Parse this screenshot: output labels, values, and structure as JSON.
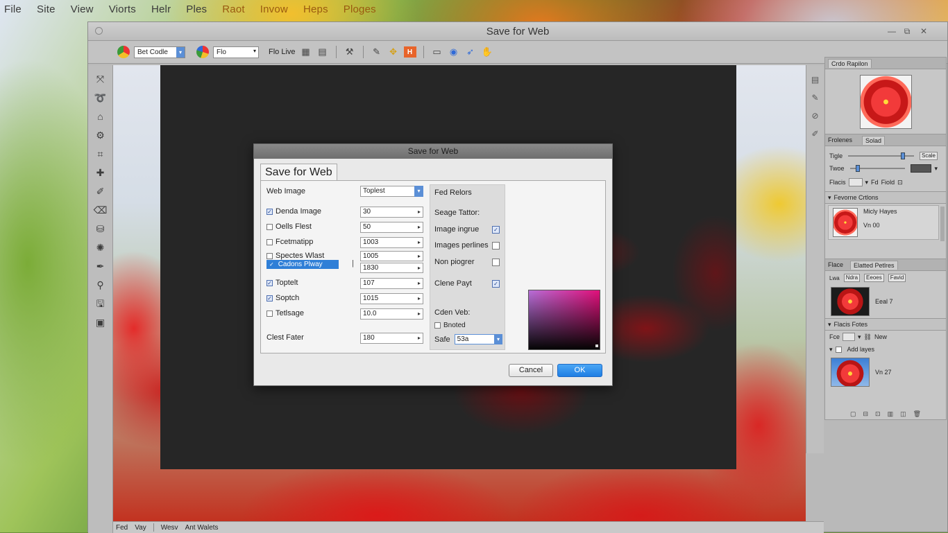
{
  "os_menu": [
    "File",
    "Site",
    "View",
    "Viorts",
    "Helr",
    "Ples",
    "Raot",
    "Invow",
    "Heps",
    "Ploges"
  ],
  "app": {
    "title": "Save for Web",
    "window_controls": [
      "—",
      "⧉",
      "✕"
    ]
  },
  "options_bar": {
    "select1": "Bet Codle",
    "select2": "Flo",
    "label": "Flo Live"
  },
  "statusbar": [
    "Fed",
    "Vay",
    "Wesv",
    "Ant Walets"
  ],
  "panels": {
    "color_sample": {
      "tab": "Crdo Rapilon"
    },
    "properties": {
      "tab1": "Frolenes",
      "tab2": "Solad",
      "row1_label": "Tigle",
      "row1_value": "Scale",
      "row2_label": "Twoe",
      "row3_label": "Flacis",
      "row3_extra": "Fd",
      "row3_select": "Fiold"
    },
    "favorites": {
      "header": "Fevorne Crtlons",
      "item_title": "Micly Hayes",
      "item_sub": "Vn 00"
    },
    "layers": {
      "tab1": "Flace",
      "tab2": "Elatted Petlres",
      "controls": [
        "Lwa",
        "Ndra",
        "Eeoes",
        "Favid"
      ],
      "item1": "Eeal 7"
    },
    "flat": {
      "header": "Flacis Fotes",
      "row_label": "Fce",
      "new_label": "New",
      "add_label": "Add layes",
      "item": "Vn 27"
    }
  },
  "dialog": {
    "title": "Save for Web",
    "tab": "Save for Web",
    "web_image_label": "Web Image",
    "web_image_value": "Toplest",
    "options": [
      {
        "label": "Denda Image",
        "checked": true,
        "value": "30"
      },
      {
        "label": "Oells Flest",
        "checked": false,
        "value": "50"
      },
      {
        "label": "Fcetmatipp",
        "checked": false,
        "value": "1003"
      },
      {
        "label": "Spectes Wlast",
        "checked": false,
        "value": "1005"
      },
      {
        "label": "Cadons Plway",
        "checked": true,
        "value": "1830",
        "highlighted": true
      },
      {
        "label": "Toptelt",
        "checked": true,
        "value": "107"
      },
      {
        "label": "Soptch",
        "checked": true,
        "value": "1015"
      },
      {
        "label": "Tetlsage",
        "checked": false,
        "value": "10.0"
      }
    ],
    "bottom_label": "Clest Fater",
    "bottom_value": "180",
    "right_group": {
      "header": "Fed Relors",
      "sub": "Seage Tattor:",
      "rows": [
        {
          "label": "Image ingrue",
          "checked": true
        },
        {
          "label": "Images perlines",
          "checked": false
        },
        {
          "label": "Non piogrer",
          "checked": false
        },
        {
          "label": "Clene Payt",
          "checked": true
        }
      ],
      "color_label": "Cden Veb:",
      "color_option": "Bnoted",
      "safe_label": "Safe",
      "safe_value": "53a"
    },
    "cancel_label": "Cancel",
    "ok_label": "OK"
  }
}
